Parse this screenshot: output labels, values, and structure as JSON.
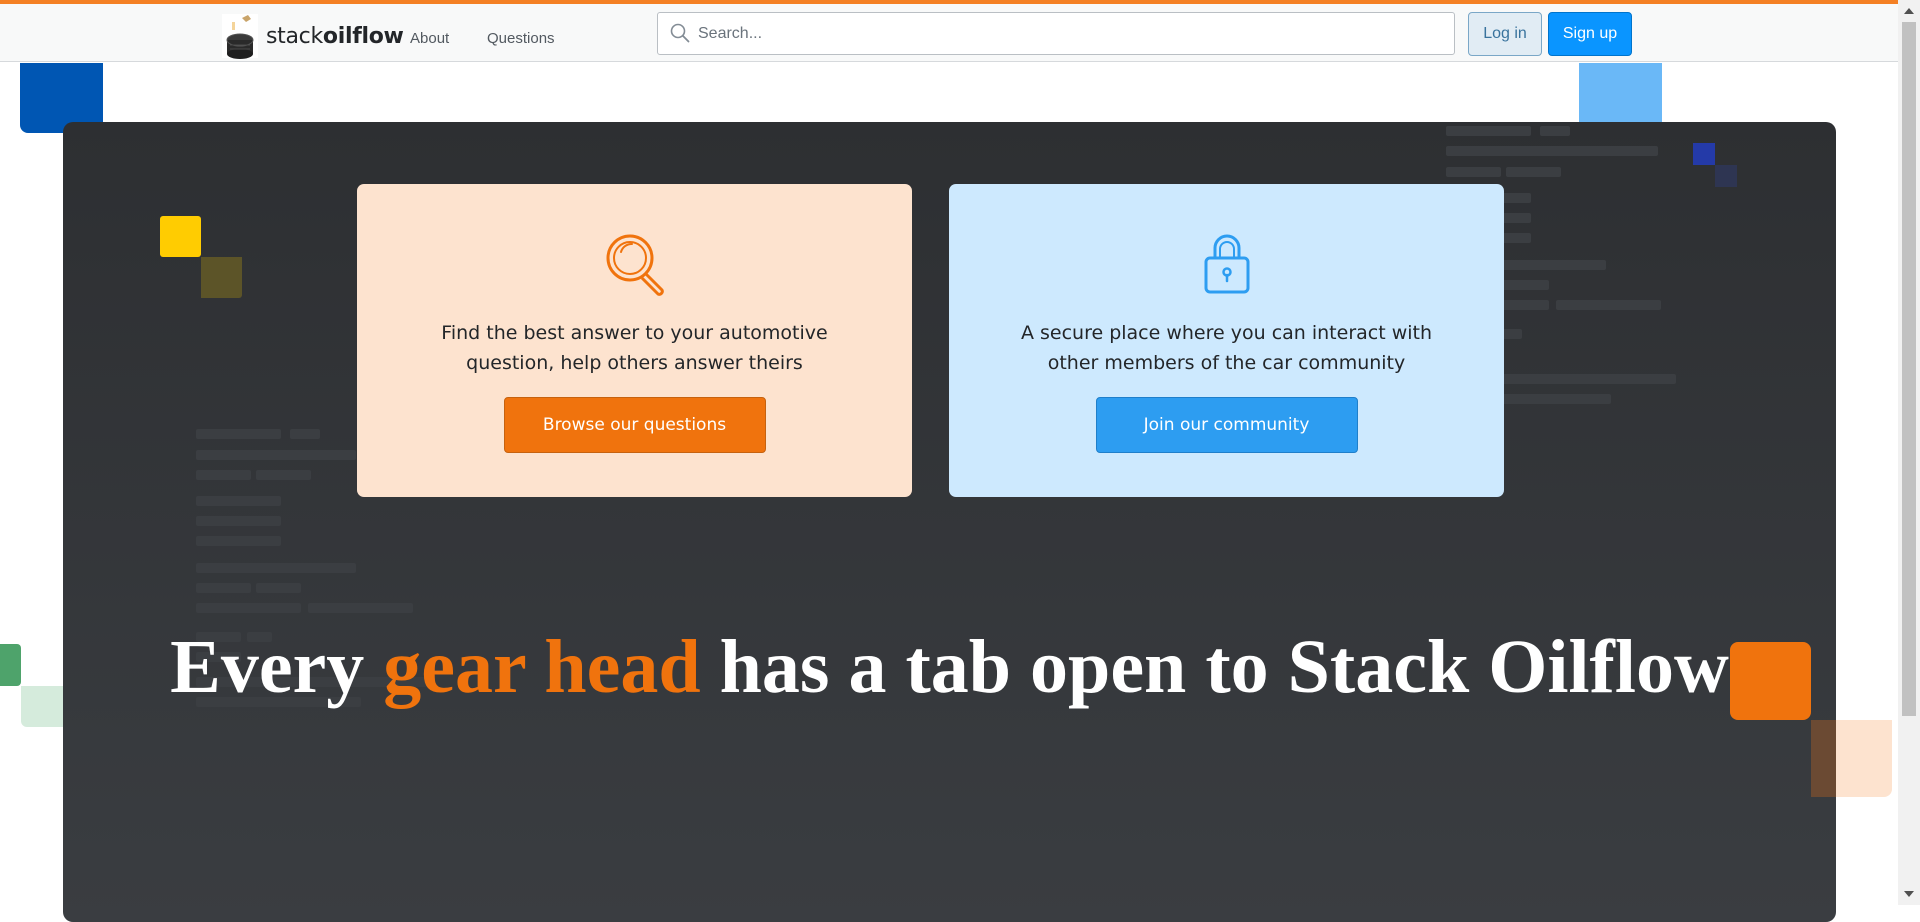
{
  "brand": {
    "name_light": "stack",
    "name_bold": "oilflow",
    "accent_color": "#f48024",
    "logo_icon": "oil-can-icon"
  },
  "nav": {
    "about": "About",
    "questions": "Questions"
  },
  "search": {
    "placeholder": "Search...",
    "icon": "search-icon"
  },
  "auth": {
    "login_label": "Log in",
    "signup_label": "Sign up"
  },
  "cards": {
    "find": {
      "icon": "magnifier-icon",
      "text": "Find the best answer to your automotive question, help others answer theirs",
      "button_label": "Browse our questions",
      "color": "#f0730d",
      "background": "#fde3cf"
    },
    "community": {
      "icon": "lock-icon",
      "text": "A secure place where you can interact with other members of the car community",
      "button_label": "Join our community",
      "color": "#2d9df1",
      "background": "#cde9fe"
    }
  },
  "hero": {
    "headline_start": "Every ",
    "headline_accent": "gear head",
    "headline_end": " has a tab open to Stack Oilflow",
    "background": "#2d2f32"
  }
}
